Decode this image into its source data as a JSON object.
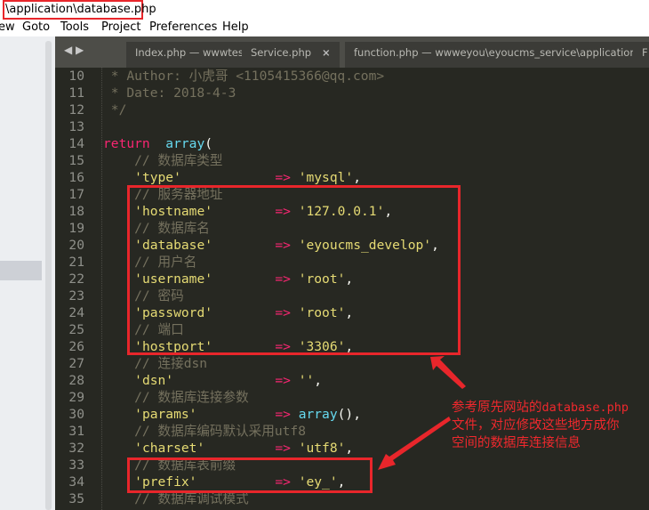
{
  "window": {
    "title": "\\application\\database.php"
  },
  "menu": [
    "ew",
    "Goto",
    "Tools",
    "Project",
    "Preferences",
    "Help"
  ],
  "tabs": [
    {
      "label": "Index.php — wwwtest\\..."
    },
    {
      "label": "Service.php"
    },
    {
      "label": "function.php — wwweyou\\eyoucms_service\\application"
    },
    {
      "label": "F"
    }
  ],
  "code": [
    {
      "n": "10",
      "parts": [
        [
          "c",
          " * Author: 小虎哥 <1105415366@qq.com>"
        ]
      ]
    },
    {
      "n": "11",
      "parts": [
        [
          "c",
          " * Date: 2018-4-3"
        ]
      ]
    },
    {
      "n": "12",
      "parts": [
        [
          "c",
          " */"
        ]
      ]
    },
    {
      "n": "13",
      "parts": []
    },
    {
      "n": "14",
      "parts": [
        [
          "k",
          "return"
        ],
        [
          "",
          "  "
        ],
        [
          "f",
          "array"
        ],
        [
          "",
          "("
        ]
      ]
    },
    {
      "n": "15",
      "parts": [
        [
          "c",
          "    // 数据库类型"
        ]
      ]
    },
    {
      "n": "16",
      "parts": [
        [
          "",
          "    "
        ],
        [
          "s",
          "'type'"
        ],
        [
          "",
          "            "
        ],
        [
          "k",
          "=>"
        ],
        [
          "",
          " "
        ],
        [
          "s",
          "'mysql'"
        ],
        [
          "",
          ","
        ]
      ]
    },
    {
      "n": "17",
      "parts": [
        [
          "c",
          "    // 服务器地址"
        ]
      ]
    },
    {
      "n": "18",
      "parts": [
        [
          "",
          "    "
        ],
        [
          "s",
          "'hostname'"
        ],
        [
          "",
          "        "
        ],
        [
          "k",
          "=>"
        ],
        [
          "",
          " "
        ],
        [
          "s",
          "'127.0.0.1'"
        ],
        [
          "",
          ","
        ]
      ]
    },
    {
      "n": "19",
      "parts": [
        [
          "c",
          "    // 数据库名"
        ]
      ]
    },
    {
      "n": "20",
      "parts": [
        [
          "",
          "    "
        ],
        [
          "s",
          "'database'"
        ],
        [
          "",
          "        "
        ],
        [
          "k",
          "=>"
        ],
        [
          "",
          " "
        ],
        [
          "s",
          "'eyoucms_develop'"
        ],
        [
          "",
          ","
        ]
      ]
    },
    {
      "n": "21",
      "parts": [
        [
          "c",
          "    // 用户名"
        ]
      ]
    },
    {
      "n": "22",
      "parts": [
        [
          "",
          "    "
        ],
        [
          "s",
          "'username'"
        ],
        [
          "",
          "        "
        ],
        [
          "k",
          "=>"
        ],
        [
          "",
          " "
        ],
        [
          "s",
          "'root'"
        ],
        [
          "",
          ","
        ]
      ]
    },
    {
      "n": "23",
      "parts": [
        [
          "c",
          "    // 密码"
        ]
      ]
    },
    {
      "n": "24",
      "parts": [
        [
          "",
          "    "
        ],
        [
          "s",
          "'password'"
        ],
        [
          "",
          "        "
        ],
        [
          "k",
          "=>"
        ],
        [
          "",
          " "
        ],
        [
          "s",
          "'root'"
        ],
        [
          "",
          ","
        ]
      ]
    },
    {
      "n": "25",
      "parts": [
        [
          "c",
          "    // 端口"
        ]
      ]
    },
    {
      "n": "26",
      "parts": [
        [
          "",
          "    "
        ],
        [
          "s",
          "'hostport'"
        ],
        [
          "",
          "        "
        ],
        [
          "k",
          "=>"
        ],
        [
          "",
          " "
        ],
        [
          "s",
          "'3306'"
        ],
        [
          "",
          ","
        ]
      ]
    },
    {
      "n": "27",
      "parts": [
        [
          "c",
          "    // 连接dsn"
        ]
      ]
    },
    {
      "n": "28",
      "parts": [
        [
          "",
          "    "
        ],
        [
          "s",
          "'dsn'"
        ],
        [
          "",
          "             "
        ],
        [
          "k",
          "=>"
        ],
        [
          "",
          " "
        ],
        [
          "s",
          "''"
        ],
        [
          "",
          ","
        ]
      ]
    },
    {
      "n": "29",
      "parts": [
        [
          "c",
          "    // 数据库连接参数"
        ]
      ]
    },
    {
      "n": "30",
      "parts": [
        [
          "",
          "    "
        ],
        [
          "s",
          "'params'"
        ],
        [
          "",
          "          "
        ],
        [
          "k",
          "=>"
        ],
        [
          "",
          " "
        ],
        [
          "f",
          "array"
        ],
        [
          "",
          "(),"
        ]
      ]
    },
    {
      "n": "31",
      "parts": [
        [
          "c",
          "    // 数据库编码默认采用utf8"
        ]
      ]
    },
    {
      "n": "32",
      "parts": [
        [
          "",
          "    "
        ],
        [
          "s",
          "'charset'"
        ],
        [
          "",
          "         "
        ],
        [
          "k",
          "=>"
        ],
        [
          "",
          " "
        ],
        [
          "s",
          "'utf8'"
        ],
        [
          "",
          ","
        ]
      ]
    },
    {
      "n": "33",
      "parts": [
        [
          "c",
          "    // 数据库表前缀"
        ]
      ]
    },
    {
      "n": "34",
      "parts": [
        [
          "",
          "    "
        ],
        [
          "s",
          "'prefix'"
        ],
        [
          "",
          "          "
        ],
        [
          "k",
          "=>"
        ],
        [
          "",
          " "
        ],
        [
          "s",
          "'ey_'"
        ],
        [
          "",
          ","
        ]
      ]
    },
    {
      "n": "35",
      "parts": [
        [
          "c",
          "    // 数据库调试模式"
        ]
      ]
    }
  ],
  "annotation": {
    "line1_a": "参考原先网站的",
    "line1_b": "database.php",
    "line2": "文件，对应修改这些地方成你",
    "line3": "空间的数据库连接信息"
  },
  "colors": {
    "highlight": "#e8262b",
    "editor_bg": "#272822"
  }
}
